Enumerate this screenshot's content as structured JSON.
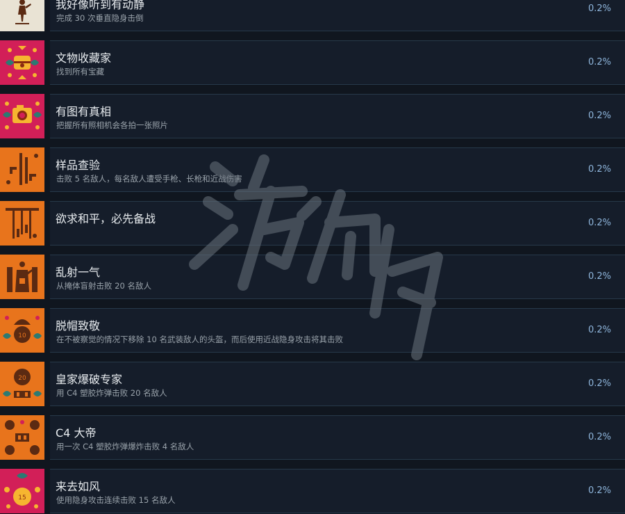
{
  "achievements": [
    {
      "title": "我好像听到有动静",
      "description": "完成 30 次垂直隐身击倒",
      "percent": "0.2%",
      "icon": "assassin-figure-icon",
      "color": "#e9e3d4"
    },
    {
      "title": "文物收藏家",
      "description": "找到所有宝藏",
      "percent": "0.2%",
      "icon": "treasure-chest-icon",
      "color": "#d21f58"
    },
    {
      "title": "有图有真相",
      "description": "把握所有照相机会各拍一张照片",
      "percent": "0.2%",
      "icon": "camera-icon",
      "color": "#d21f58"
    },
    {
      "title": "样品查验",
      "description": "击败 5 名敌人，每名敌人遭受手枪、长枪和近战伤害",
      "percent": "0.2%",
      "icon": "weapons-icon",
      "color": "#e8741c"
    },
    {
      "title": "欲求和平，必先备战",
      "description": "",
      "percent": "0.2%",
      "icon": "weapon-rack-icon",
      "color": "#e8741c"
    },
    {
      "title": "乱射一气",
      "description": "从掩体盲射击败 20 名敌人",
      "percent": "0.2%",
      "icon": "blind-fire-icon",
      "color": "#e8741c"
    },
    {
      "title": "脱帽致敬",
      "description": "在不被察觉的情况下移除 10 名武装敌人的头盔，而后使用近战隐身攻击将其击败",
      "percent": "0.2%",
      "icon": "helmet-skull-icon",
      "color": "#e8741c"
    },
    {
      "title": "皇家爆破专家",
      "description": "用 C4 塑胶炸弹击败 20 名敌人",
      "percent": "0.2%",
      "icon": "skull-20-icon",
      "color": "#e8741c"
    },
    {
      "title": "C4 大帝",
      "description": "用一次 C4 塑胶炸弹爆炸击败 4 名敌人",
      "percent": "0.2%",
      "icon": "four-skulls-icon",
      "color": "#e8741c"
    },
    {
      "title": "来去如风",
      "description": "使用隐身攻击连续击败 15 名敌人",
      "percent": "0.2%",
      "icon": "skull-15-icon",
      "color": "#d21f58"
    }
  ],
  "icon_numbers": {
    "helmet": "10",
    "demolition": "20",
    "wind": "15"
  }
}
